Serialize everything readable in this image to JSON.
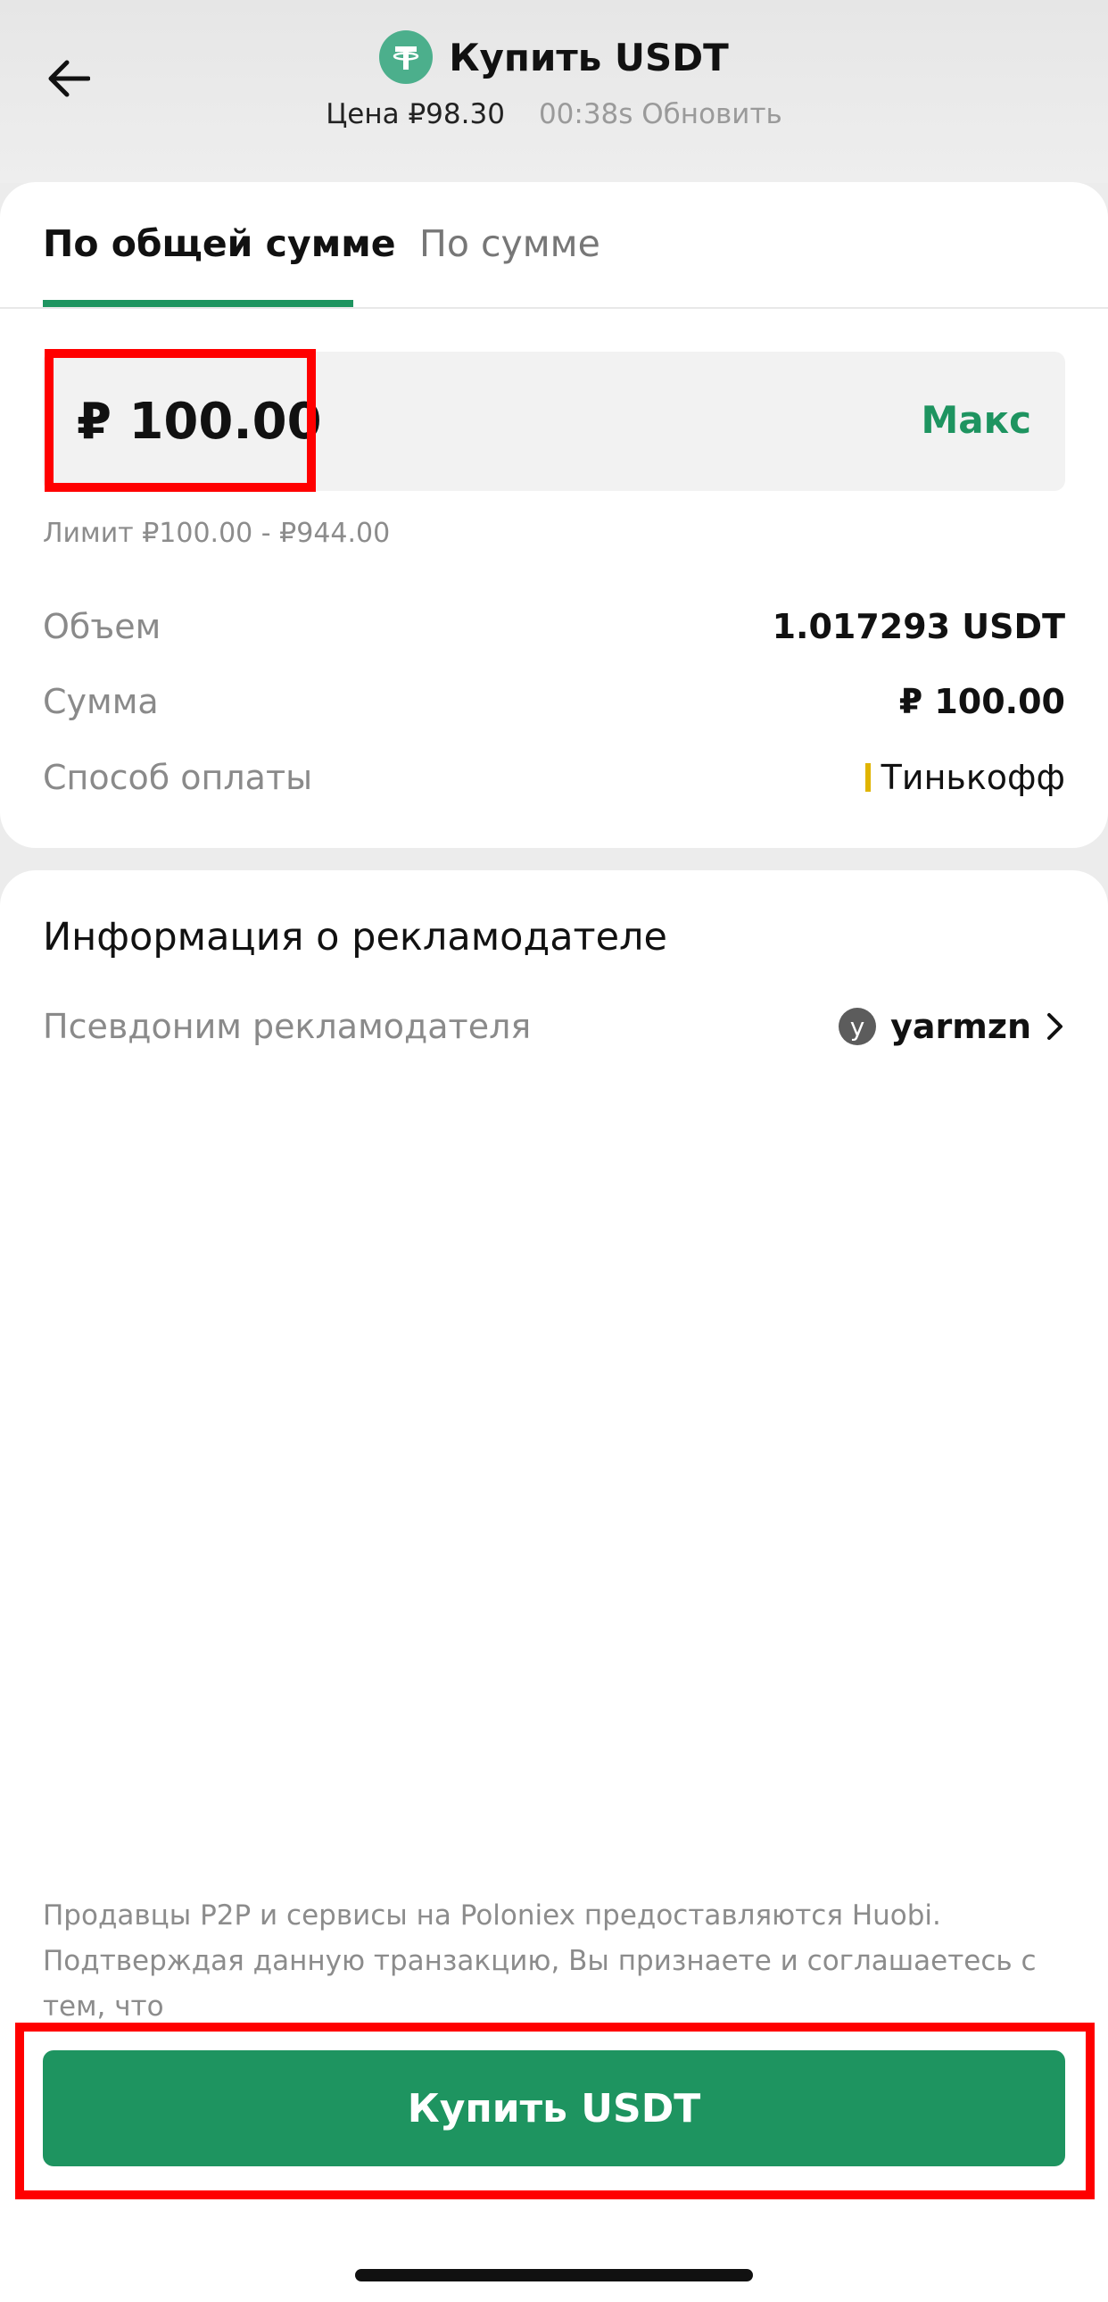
{
  "header": {
    "title": "Купить USDT",
    "price": "Цена ₽98.30",
    "refresh": "00:38s Обновить"
  },
  "tabs": [
    {
      "label": "По общей сумме",
      "active": true
    },
    {
      "label": "По сумме",
      "active": false
    }
  ],
  "amount": {
    "value": "₽ 100.00",
    "max_label": "Макс",
    "limit": "Лимит ₽100.00 - ₽944.00"
  },
  "details": {
    "volume_label": "Объем",
    "volume_value": "1.017293 USDT",
    "sum_label": "Сумма",
    "sum_value": "₽ 100.00",
    "payment_label": "Способ оплаты",
    "payment_value": "Тинькофф"
  },
  "advertiser": {
    "section_title": "Информация о рекламодателе",
    "nickname_label": "Псевдоним рекламодателя",
    "avatar_letter": "y",
    "nickname": "yarmzn"
  },
  "footer": {
    "disclaimer": "Продавцы P2P и сервисы на Poloniex предоставляются Huobi. Подтверждая данную транзакцию, Вы признаете и соглашаетесь с тем, что",
    "buy_button": "Купить USDT"
  },
  "colors": {
    "accent": "#1e9460",
    "highlight": "#ff0000",
    "payment_marker": "#e0b400",
    "coin": "#4caf8c"
  }
}
